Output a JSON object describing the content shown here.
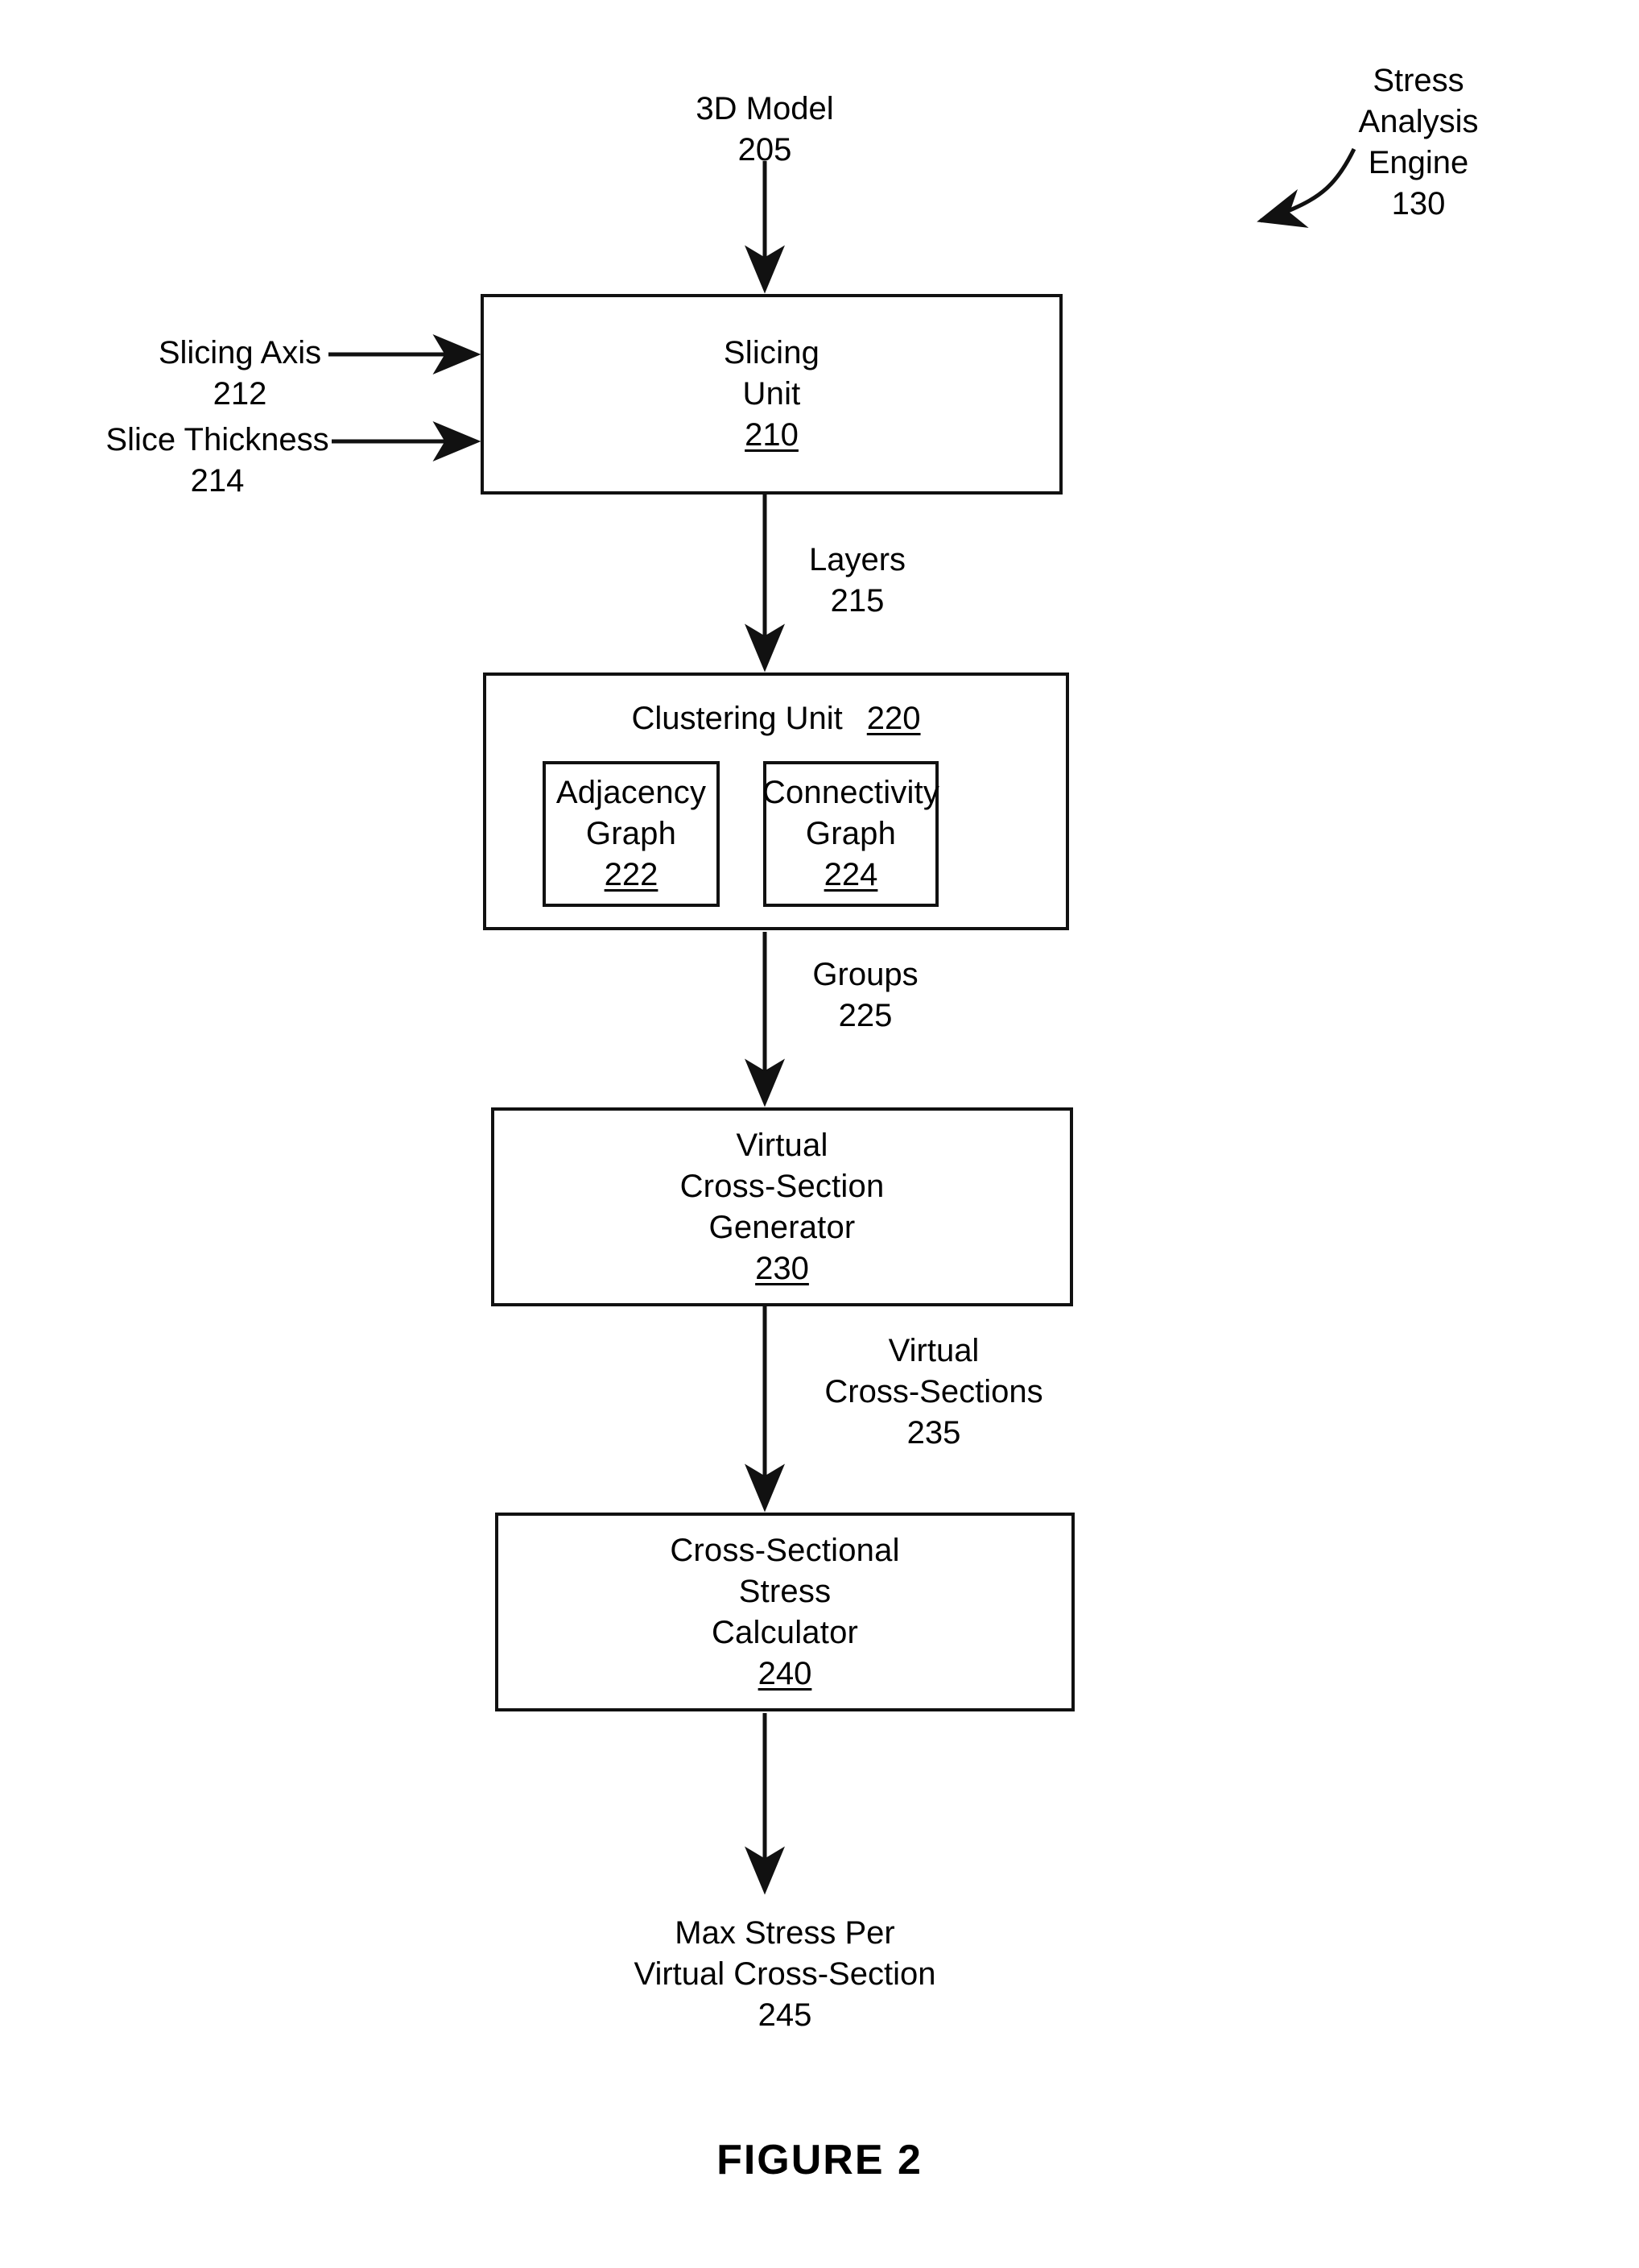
{
  "figure": {
    "caption": "FIGURE 2"
  },
  "annotation": {
    "engine_line1": "Stress",
    "engine_line2": "Analysis",
    "engine_line3": "Engine",
    "engine_ref": "130",
    "pointer_icon": "curved-arrow-icon"
  },
  "inputs": {
    "model_label": "3D Model",
    "model_ref": "205",
    "slicing_axis_label": "Slicing Axis",
    "slicing_axis_ref": "212",
    "slice_thickness_label": "Slice Thickness",
    "slice_thickness_ref": "214"
  },
  "blocks": {
    "slicing_unit": {
      "line1": "Slicing",
      "line2": "Unit",
      "ref": "210"
    },
    "clustering_unit": {
      "title": "Clustering Unit",
      "ref": "220",
      "children": [
        {
          "line1": "Adjacency",
          "line2": "Graph",
          "ref": "222"
        },
        {
          "line1": "Connectivity",
          "line2": "Graph",
          "ref": "224"
        }
      ]
    },
    "virtual_cross_section_generator": {
      "line1": "Virtual",
      "line2": "Cross-Section",
      "line3": "Generator",
      "ref": "230"
    },
    "cross_sectional_stress_calculator": {
      "line1": "Cross-Sectional",
      "line2": "Stress",
      "line3": "Calculator",
      "ref": "240"
    }
  },
  "flows": {
    "layers_label": "Layers",
    "layers_ref": "215",
    "groups_label": "Groups",
    "groups_ref": "225",
    "vcs_label_line1": "Virtual",
    "vcs_label_line2": "Cross-Sections",
    "vcs_ref": "235"
  },
  "output": {
    "line1": "Max Stress Per",
    "line2": "Virtual Cross-Section",
    "ref": "245"
  },
  "colors": {
    "ink": "#111111",
    "background": "#ffffff"
  }
}
